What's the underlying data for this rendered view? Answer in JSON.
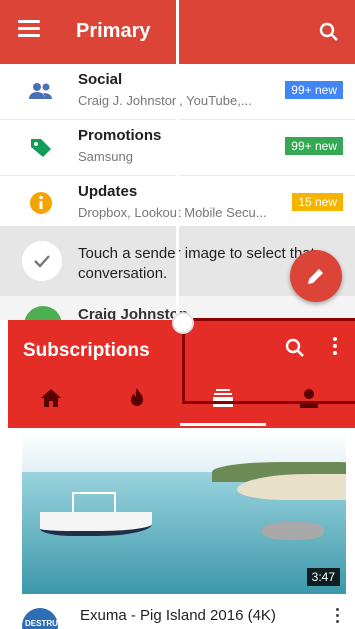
{
  "gmail": {
    "title": "Primary",
    "categories": [
      {
        "name": "Social",
        "sub": "Craig J. Johnston, YouTube,...",
        "badge": "99+ new",
        "badge_color": "#4285f4",
        "icon": "people-icon",
        "icon_color": "#4a6fb6"
      },
      {
        "name": "Promotions",
        "sub": "Samsung",
        "badge": "99+ new",
        "badge_color": "#34a853",
        "icon": "tag-icon",
        "icon_color": "#0f9d58"
      },
      {
        "name": "Updates",
        "sub": "Dropbox, Lookout Mobile Secu...",
        "badge": "15 new",
        "badge_color": "#f4b400",
        "icon": "info-icon",
        "icon_color": "#f4a400"
      }
    ],
    "tip": "Touch a sender image to select that conversation.",
    "next_sender": "Craig Johnston",
    "accent": "#db4437"
  },
  "youtube": {
    "title": "Subscriptions",
    "tabs": [
      {
        "name": "home-icon",
        "active": false
      },
      {
        "name": "trending-icon",
        "active": false
      },
      {
        "name": "subscriptions-icon",
        "active": true
      },
      {
        "name": "account-icon",
        "active": false
      }
    ],
    "video": {
      "duration": "3:47",
      "title": "Exuma - Pig Island 2016 (4K)",
      "channel_initials": "DESTRU"
    },
    "accent": "#e52d27"
  }
}
